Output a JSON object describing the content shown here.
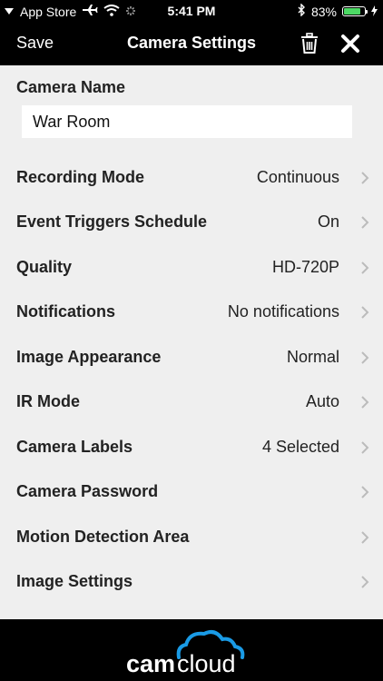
{
  "status": {
    "carrier": "App Store",
    "time": "5:41 PM",
    "battery": "83%",
    "battery_level": 0.83
  },
  "nav": {
    "save": "Save",
    "title": "Camera Settings"
  },
  "camera_name": {
    "label": "Camera Name",
    "value": "War Room"
  },
  "rows": [
    {
      "label": "Recording Mode",
      "value": "Continuous"
    },
    {
      "label": "Event Triggers Schedule",
      "value": "On"
    },
    {
      "label": "Quality",
      "value": "HD-720P"
    },
    {
      "label": "Notifications",
      "value": "No notifications"
    },
    {
      "label": "Image Appearance",
      "value": "Normal"
    },
    {
      "label": "IR Mode",
      "value": "Auto"
    },
    {
      "label": "Camera Labels",
      "value": "4 Selected"
    },
    {
      "label": "Camera Password",
      "value": ""
    },
    {
      "label": "Motion Detection Area",
      "value": ""
    },
    {
      "label": "Image Settings",
      "value": ""
    }
  ],
  "footer": {
    "logo_cam": "cam",
    "logo_cloud": "cloud"
  },
  "colors": {
    "accent": "#1a9be6",
    "battery": "#4cd964"
  }
}
